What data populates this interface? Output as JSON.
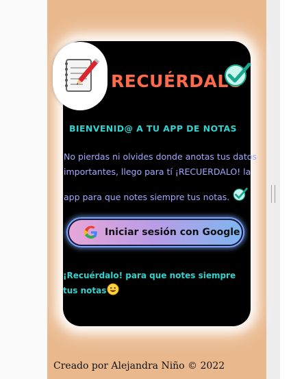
{
  "app": {
    "title": "RECUÉRDALO"
  },
  "hero": {
    "welcome": "BIENVENID@ A TU APP DE NOTAS",
    "description_line1": "No pierdas ni olvides donde anotas tus datos",
    "description_line2": "importantes, llego para tí ¡RECUERDALO! la",
    "description_line3": "app para que notes siempre tus notas."
  },
  "login": {
    "google_button_label": "Iniciar sesión con Google"
  },
  "tagline": {
    "text": "¡Recuérdalo! para que notes siempre tus notas"
  },
  "footer": {
    "text": "Creado por Alejandra Niño © 2022"
  },
  "icons": {
    "logo": "notebook-pencil-icon",
    "check": "check-mark-icon",
    "google": "google-g-icon",
    "smiley": "smiley-icon"
  },
  "colors": {
    "page_background": "#e9b88c",
    "card_background": "#000000",
    "title": "#ff6a4a",
    "accent_text": "#2fd3cf",
    "description_text": "#a3a8ff"
  }
}
